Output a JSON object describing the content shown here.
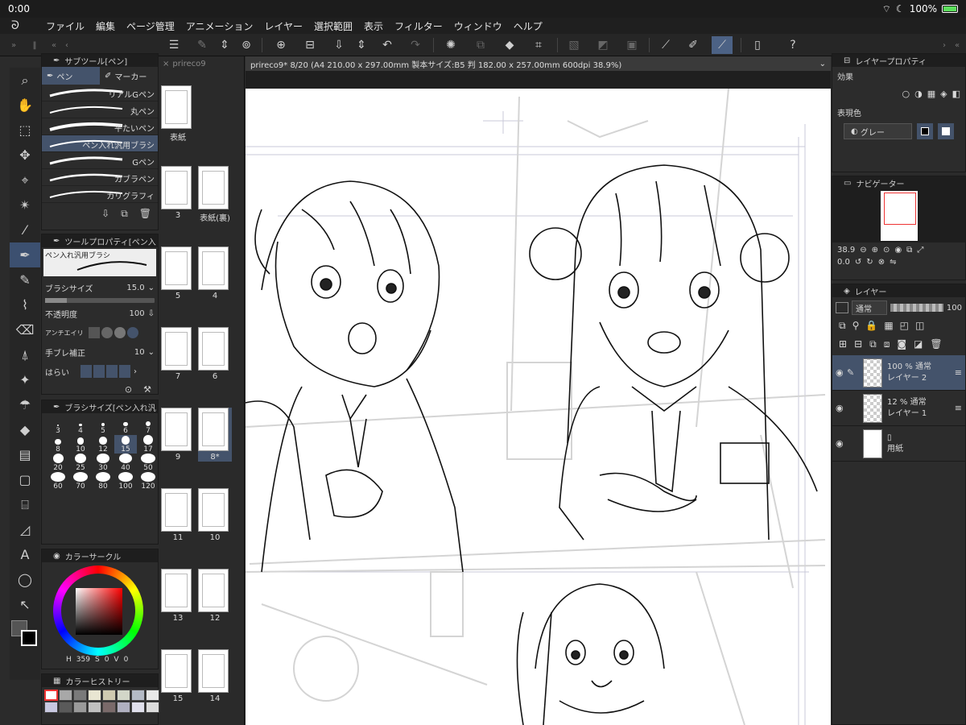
{
  "status": {
    "time": "0:00",
    "battery": "100%"
  },
  "menu": [
    "ファイル",
    "編集",
    "ページ管理",
    "アニメーション",
    "レイヤー",
    "選択範囲",
    "表示",
    "フィルター",
    "ウィンドウ",
    "ヘルプ"
  ],
  "subtool": {
    "title": "サブツール[ペン]",
    "tabs": [
      "ペン",
      "マーカー"
    ],
    "brushes": [
      "リアルGペン",
      "丸ペン",
      "平たいペン",
      "ペン入れ汎用ブラシ",
      "Gペン",
      "カブラペン",
      "カリグラフィ"
    ]
  },
  "tool_property": {
    "title": "ツールプロパティ[ペン入",
    "brush_name": "ペン入れ汎用ブラシ",
    "brush_size_label": "ブラシサイズ",
    "brush_size": "15.0",
    "opacity_label": "不透明度",
    "opacity": "100",
    "antialias_label": "アンチエイリ",
    "stabilization_label": "手ブレ補正",
    "stabilization": "10",
    "harai_label": "はらい"
  },
  "brush_size_panel": {
    "title": "ブラシサイズ[ペン入れ汎",
    "sizes": [
      "3",
      "4",
      "5",
      "6",
      "7",
      "8",
      "10",
      "12",
      "15",
      "17",
      "20",
      "25",
      "30",
      "40",
      "50",
      "60",
      "70",
      "80",
      "100",
      "120"
    ],
    "selected": "15"
  },
  "color_circle": {
    "title": "カラーサークル",
    "h": "359",
    "s": "0",
    "v": "0"
  },
  "color_history": {
    "title": "カラーヒストリー",
    "swatches": [
      "#ffffff",
      "#a8a8a8",
      "#7a7a7a",
      "#e9e6d2",
      "#cfcab0",
      "#d2d6c8",
      "#b4bac6",
      "#e8e8e8",
      "#c8c8e0",
      "#5a5a5a",
      "#9a9a9a",
      "#c0c0c0",
      "#7a6a6a",
      "#b0b0c0",
      "#e0e0ec",
      "#dcdcdc"
    ]
  },
  "pages": {
    "tab": "prireco9",
    "items": [
      [
        "表紙"
      ],
      [
        "3",
        "表紙(裏)"
      ],
      [
        "5",
        "4"
      ],
      [
        "7",
        "6"
      ],
      [
        "9",
        "8*"
      ],
      [
        "11",
        "10"
      ],
      [
        "13",
        "12"
      ],
      [
        "15",
        "14"
      ]
    ]
  },
  "doc_tab": "prireco9* 8/20 (A4 210.00 x 297.00mm 製本サイズ:B5 判 182.00 x 257.00mm 600dpi 38.9%)",
  "layer_property": {
    "title": "レイヤープロパティ",
    "effect": "効果",
    "expression_color": "表現色",
    "color_mode": "グレー"
  },
  "navigator": {
    "title": "ナビゲーター",
    "zoom": "38.9",
    "rotation": "0.0"
  },
  "layers": {
    "title": "レイヤー",
    "blend": "通常",
    "opacity": "100",
    "items": [
      {
        "opacity": "100 %",
        "mode": "通常",
        "name": "レイヤー 2"
      },
      {
        "opacity": "12 %",
        "mode": "通常",
        "name": "レイヤー 1"
      },
      {
        "opacity": "",
        "mode": "",
        "name": "用紙"
      }
    ]
  },
  "colors": {
    "accent": "#44536b",
    "panel": "#2c2c2c",
    "bg": "#1e1e1e"
  }
}
